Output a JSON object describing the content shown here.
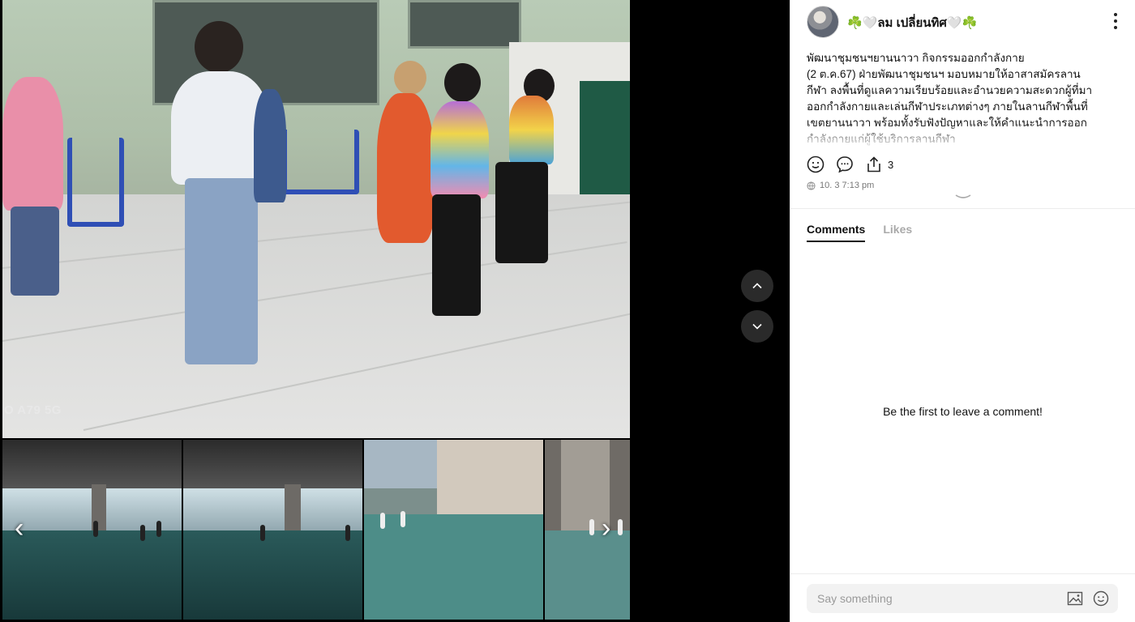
{
  "media": {
    "watermark": "O A79 5G",
    "prev_thumb_label": "‹",
    "next_thumb_label": "›"
  },
  "nav": {
    "up_label": "previous-post",
    "down_label": "next-post"
  },
  "post": {
    "author": "☘️🤍ลม เปลี่ยนทิศ🤍☘️",
    "text": "พัฒนาชุมชนฯยานนาวา กิจกรรมออกกำลังกาย\n (2 ต.ค.67) ฝ่ายพัฒนาชุมชนฯ มอบหมายให้อาสาสมัครลาน\nกีฬา ลงพื้นที่ดูแลความเรียบร้อยและอำนวยความสะดวกผู้ที่มา\nออกกำลังกายและเล่นกีฬาประเภทต่างๆ ภายในลานกีฬาพื้นที่\nเขตยานนาวา พร้อมทั้งรับฟังปัญหาและให้คำแนะนำการออก\nกำลังกายแก่ผู้ใช้บริการลานกีฬา",
    "share_count": "3",
    "timestamp": "10. 3 7:13 pm"
  },
  "tabs": {
    "comments": "Comments",
    "likes": "Likes"
  },
  "comments": {
    "empty_message": "Be the first to leave a comment!",
    "placeholder": "Say something"
  },
  "colors": {
    "accent": "#111111",
    "muted": "#aaaaaa",
    "input_bg": "#f2f2f2"
  }
}
